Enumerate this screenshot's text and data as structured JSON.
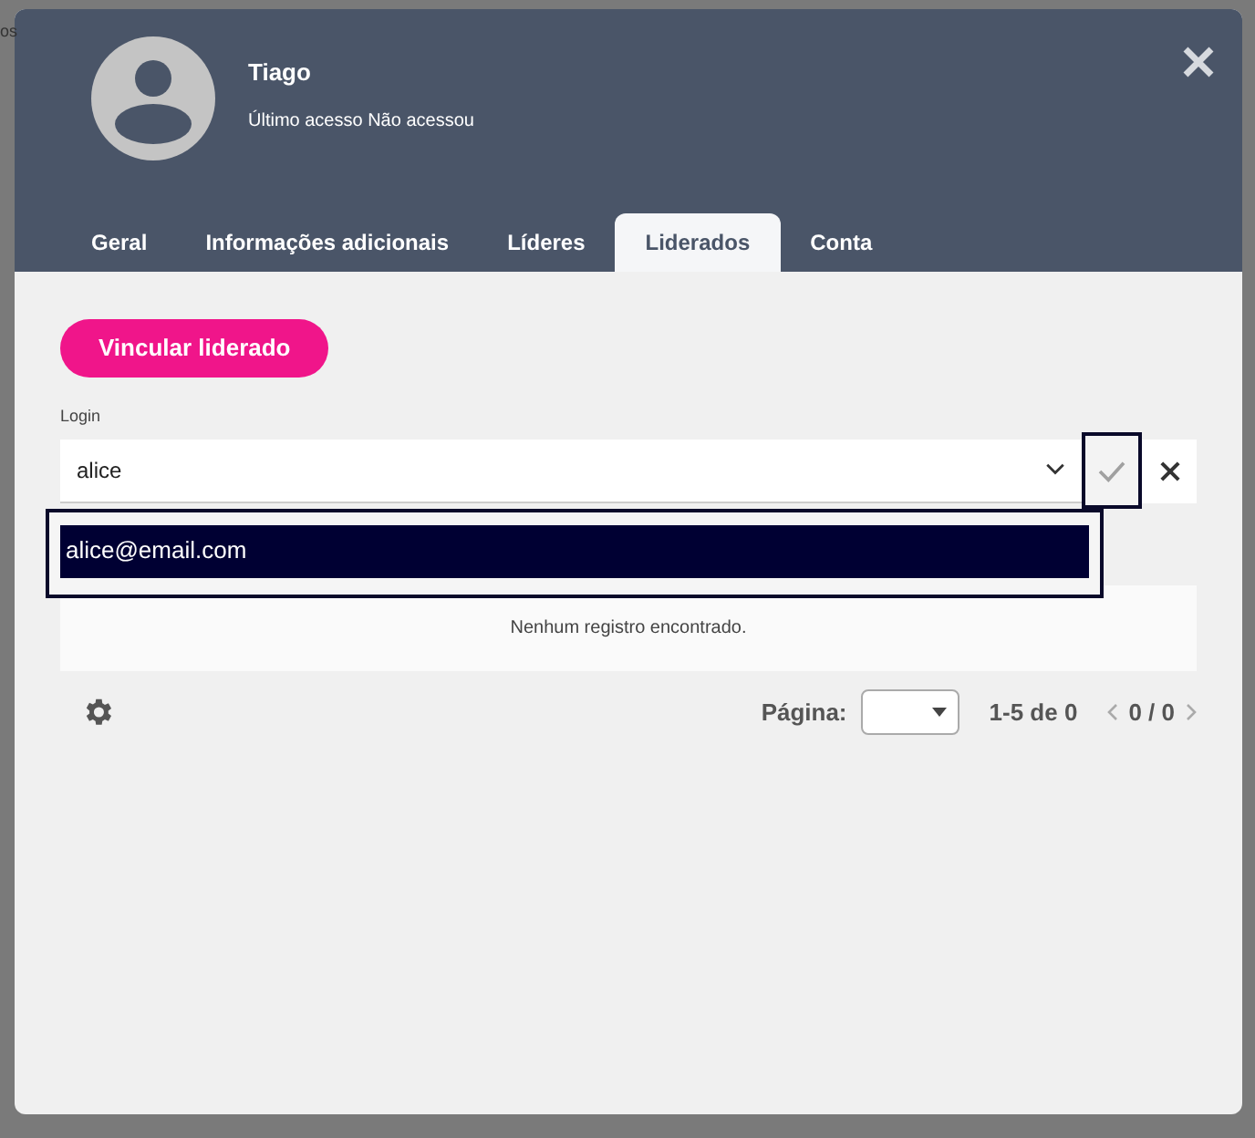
{
  "background_text": "os",
  "profile": {
    "name": "Tiago",
    "last_access": "Último acesso Não acessou"
  },
  "tabs": [
    {
      "label": "Geral",
      "selected": false
    },
    {
      "label": "Informações adicionais",
      "selected": false
    },
    {
      "label": "Líderes",
      "selected": false
    },
    {
      "label": "Liderados",
      "selected": true
    },
    {
      "label": "Conta",
      "selected": false
    }
  ],
  "add_button": "Vincular liderado",
  "login": {
    "label": "Login",
    "value": "alice"
  },
  "suggestions": [
    {
      "label": "alice@email.com",
      "selected": true
    }
  ],
  "empty_message": "Nenhum registro encontrado.",
  "pagination": {
    "page_label": "Página:",
    "range": "1-5 de 0",
    "pages": "0 / 0"
  }
}
